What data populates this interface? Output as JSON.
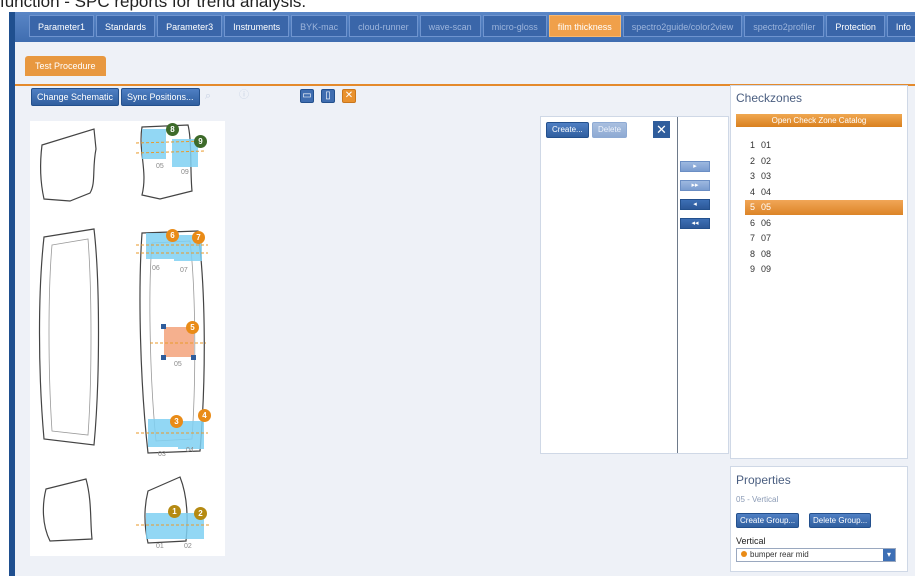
{
  "caption": "function - SPC reports for trend analysis.",
  "tabs": [
    {
      "label": "Parameter1",
      "state": "normal"
    },
    {
      "label": "Standards",
      "state": "normal"
    },
    {
      "label": "Parameter3",
      "state": "normal"
    },
    {
      "label": "Instruments",
      "state": "normal"
    },
    {
      "label": "BYK-mac",
      "state": "dim"
    },
    {
      "label": "cloud-runner",
      "state": "dim"
    },
    {
      "label": "wave-scan",
      "state": "dim"
    },
    {
      "label": "micro-gloss",
      "state": "dim"
    },
    {
      "label": "film thickness",
      "state": "active"
    },
    {
      "label": "spectro2guide/color2view",
      "state": "dim"
    },
    {
      "label": "spectro2profiler",
      "state": "dim"
    },
    {
      "label": "Protection",
      "state": "normal"
    },
    {
      "label": "Info",
      "state": "normal"
    }
  ],
  "subtab": "Test Procedure",
  "toolbar": {
    "change_schematic": "Change Schematic",
    "sync_positions": "Sync Positions..."
  },
  "schematic": {
    "zone_labels": {
      "z06": "06",
      "z07": "07",
      "z05": "05",
      "z03": "03",
      "z04": "04",
      "z01": "01",
      "z02": "02",
      "z08": "05",
      "z09": "09"
    },
    "markers": {
      "m8": "8",
      "m9": "9",
      "m6": "6",
      "m7": "7",
      "m5": "5",
      "m3": "3",
      "m4": "4",
      "m1": "1",
      "m2": "2"
    }
  },
  "middle": {
    "create": "Create...",
    "delete": "Delete",
    "arrows": [
      "▸",
      "▸▸",
      "◂",
      "◂◂"
    ]
  },
  "checkzones": {
    "title": "Checkzones",
    "catalog_button": "Open Check Zone Catalog",
    "items": [
      {
        "num": "1",
        "label": "01"
      },
      {
        "num": "2",
        "label": "02"
      },
      {
        "num": "3",
        "label": "03"
      },
      {
        "num": "4",
        "label": "04"
      },
      {
        "num": "5",
        "label": "05"
      },
      {
        "num": "6",
        "label": "06"
      },
      {
        "num": "7",
        "label": "07"
      },
      {
        "num": "8",
        "label": "08"
      },
      {
        "num": "9",
        "label": "09"
      }
    ],
    "selected_index": 4
  },
  "properties": {
    "title": "Properties",
    "subtitle": "05 - Vertical",
    "create_group": "Create Group...",
    "delete_group": "Delete Group...",
    "field_label": "Vertical",
    "field_value": "bumper rear mid"
  }
}
